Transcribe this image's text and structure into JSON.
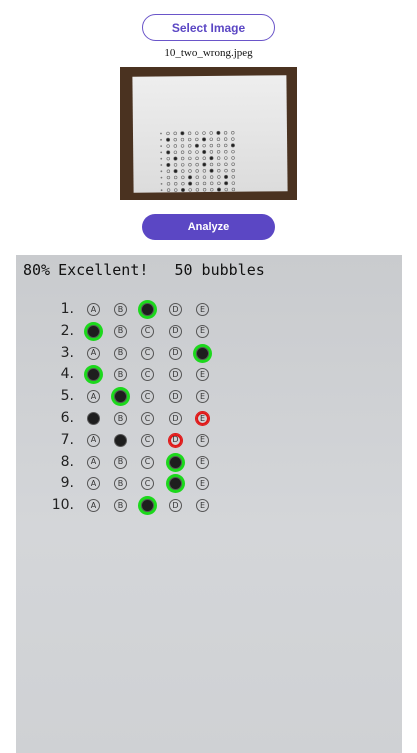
{
  "controls": {
    "select_label": "Select Image",
    "filename": "10_two_wrong.jpeg",
    "analyze_label": "Analyze"
  },
  "result": {
    "score": "80%",
    "grade": "Excellent!",
    "bubble_count": "50 bubbles"
  },
  "colors": {
    "accent": "#5b47c4",
    "correct": "#1cd81c",
    "wrong": "#e01818"
  },
  "options": [
    "A",
    "B",
    "C",
    "D",
    "E"
  ],
  "questions": [
    {
      "number": "1.",
      "filled": 2,
      "status": "correct"
    },
    {
      "number": "2.",
      "filled": 0,
      "status": "correct"
    },
    {
      "number": "3.",
      "filled": 4,
      "status": "correct"
    },
    {
      "number": "4.",
      "filled": 0,
      "status": "correct"
    },
    {
      "number": "5.",
      "filled": 1,
      "status": "correct"
    },
    {
      "number": "6.",
      "filled": 0,
      "status": "wrong",
      "expected": 4
    },
    {
      "number": "7.",
      "filled": 1,
      "status": "wrong",
      "expected": 3
    },
    {
      "number": "8.",
      "filled": 3,
      "status": "correct"
    },
    {
      "number": "9.",
      "filled": 3,
      "status": "correct"
    },
    {
      "number": "10.",
      "filled": 2,
      "status": "correct"
    }
  ]
}
